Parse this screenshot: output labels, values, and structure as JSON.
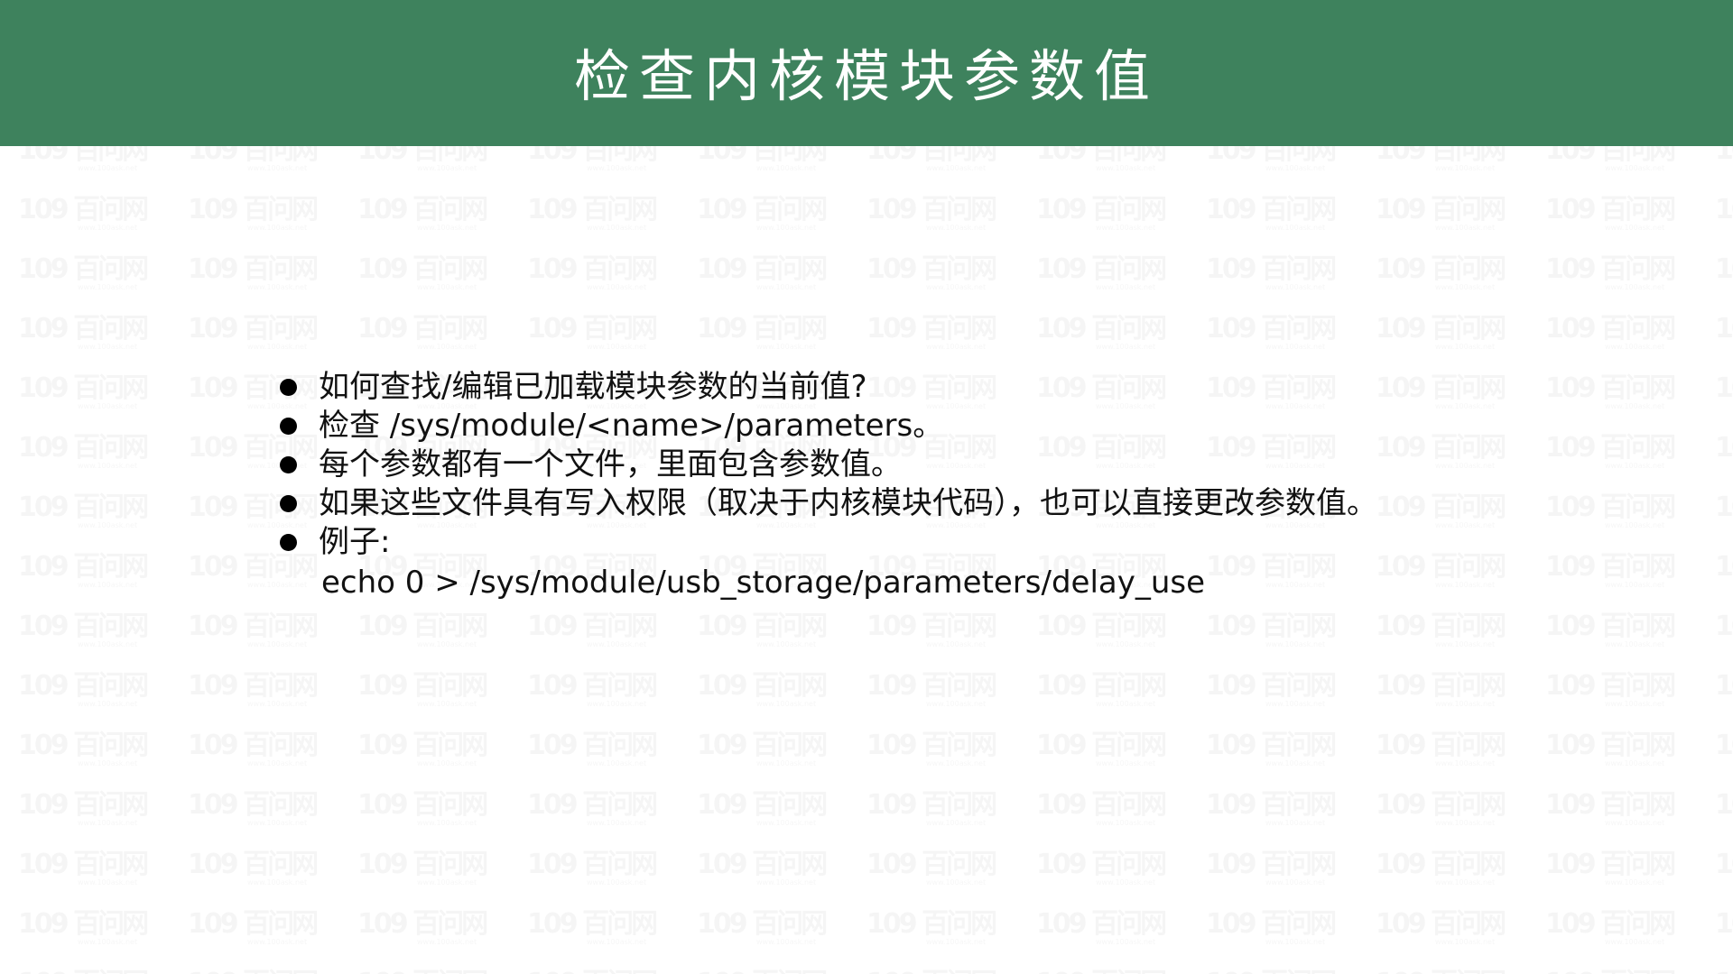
{
  "slide": {
    "title": "检查内核模块参数值",
    "bullets": [
      "如何查找/编辑已加载模块参数的当前值?",
      "检查 /sys/module/<name>/parameters。",
      "每个参数都有一个文件，里面包含参数值。",
      "如果这些文件具有写入权限（取决于内核模块代码），也可以直接更改参数值。",
      "例子:"
    ],
    "example_command": "echo 0 > /sys/module/usb_storage/parameters/delay_use"
  },
  "watermark": {
    "logo_text": "109 百问网",
    "url_text": "www.100ask.net"
  },
  "colors": {
    "header_background": "#3e825d",
    "title_text": "#ffffff",
    "body_text": "#111111",
    "bullet": "#000000"
  },
  "icons": {
    "bullet": "filled-circle"
  }
}
